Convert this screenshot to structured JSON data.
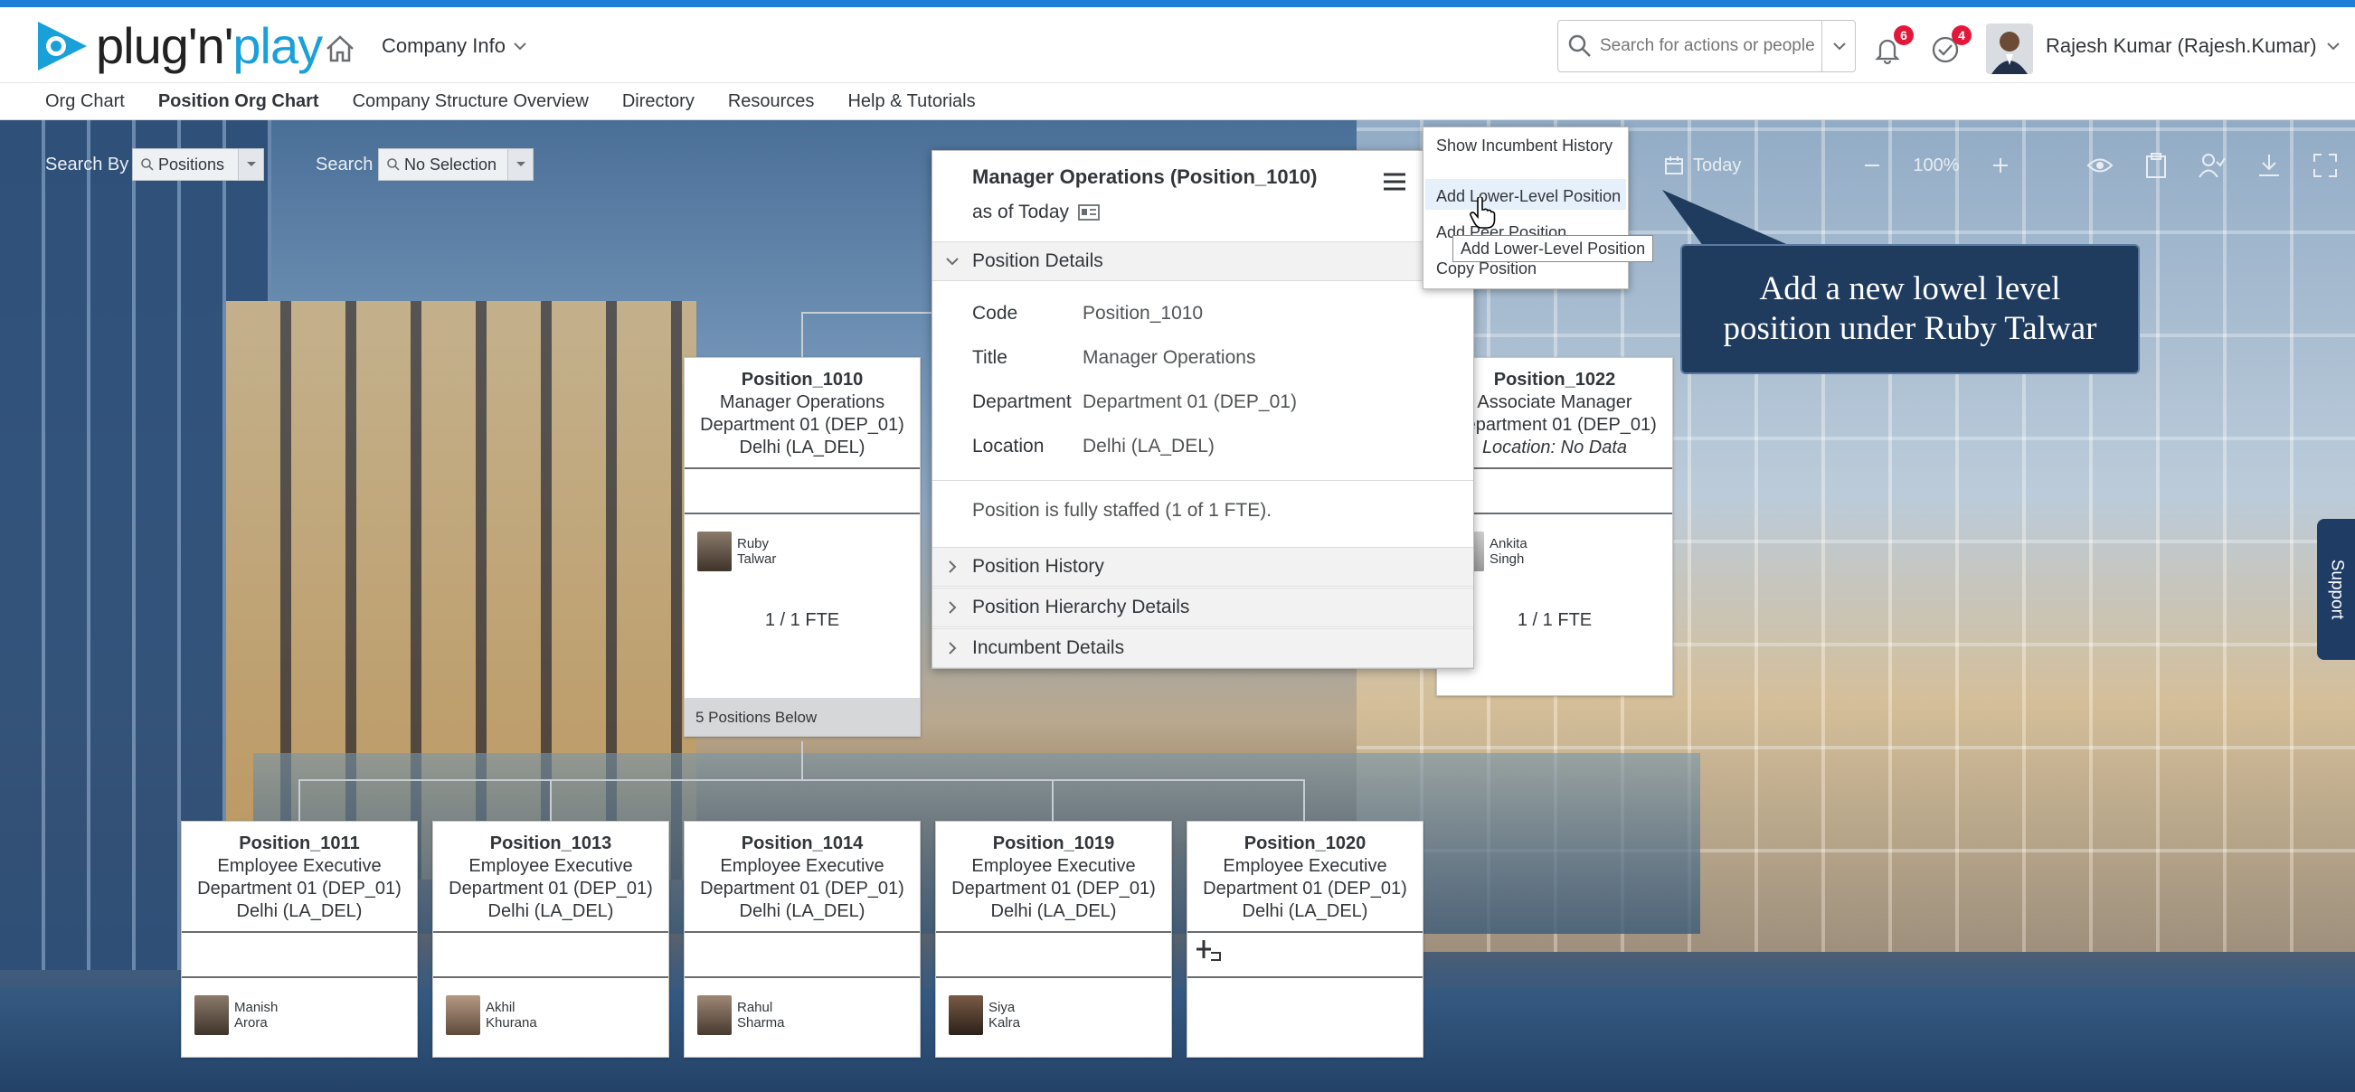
{
  "header": {
    "logo_text_a": "plug'n'",
    "logo_text_b": "play",
    "company_menu": "Company Info",
    "search_placeholder": "Search for actions or people",
    "notifications_count": "6",
    "tasks_count": "4",
    "user_name": "Rajesh Kumar (Rajesh.Kumar)"
  },
  "subnav": {
    "items": [
      "Org Chart",
      "Position Org Chart",
      "Company Structure Overview",
      "Directory",
      "Resources",
      "Help & Tutorials"
    ],
    "active_index": 1
  },
  "toolbar": {
    "search_by_label": "Search By",
    "search_by_value": "Positions",
    "search_label": "Search",
    "search_value": "No Selection",
    "date_value": "Today",
    "zoom_value": "100%"
  },
  "cards": {
    "top_left": {
      "code": "Position_1010",
      "title": "Manager Operations",
      "dept": "Department 01 (DEP_01)",
      "location": "Delhi (LA_DEL)",
      "first": "Ruby",
      "last": "Talwar",
      "fte": "1 / 1 FTE",
      "below": "5 Positions Below"
    },
    "top_right": {
      "code": "Position_1022",
      "title": "Associate Manager",
      "dept": "Department 01 (DEP_01)",
      "location": "Location: No Data",
      "first": "Ankita",
      "last": "Singh",
      "fte": "1 / 1 FTE"
    },
    "bottom": [
      {
        "code": "Position_1011",
        "title": "Employee Executive",
        "dept": "Department 01 (DEP_01)",
        "location": "Delhi (LA_DEL)",
        "first": "Manish",
        "last": "Arora"
      },
      {
        "code": "Position_1013",
        "title": "Employee Executive",
        "dept": "Department 01 (DEP_01)",
        "location": "Delhi (LA_DEL)",
        "first": "Akhil",
        "last": "Khurana"
      },
      {
        "code": "Position_1014",
        "title": "Employee Executive",
        "dept": "Department 01 (DEP_01)",
        "location": "Delhi (LA_DEL)",
        "first": "Rahul",
        "last": "Sharma"
      },
      {
        "code": "Position_1019",
        "title": "Employee Executive",
        "dept": "Department 01 (DEP_01)",
        "location": "Delhi (LA_DEL)",
        "first": "Siya",
        "last": "Kalra"
      },
      {
        "code": "Position_1020",
        "title": "Employee Executive",
        "dept": "Department 01 (DEP_01)",
        "location": "Delhi (LA_DEL)",
        "first": "",
        "last": ""
      }
    ]
  },
  "popover": {
    "title": "Manager Operations (Position_1010)",
    "as_of": "as of Today",
    "section_details": "Position Details",
    "code_label": "Code",
    "code_value": "Position_1010",
    "title_label": "Title",
    "title_value": "Manager Operations",
    "dept_label": "Department",
    "dept_value": "Department 01 (DEP_01)",
    "loc_label": "Location",
    "loc_value": "Delhi (LA_DEL)",
    "staffed": "Position is fully staffed (1 of 1 FTE).",
    "section_history": "Position History",
    "section_hierarchy": "Position Hierarchy Details",
    "section_incumbent": "Incumbent Details"
  },
  "action_menu": {
    "items": [
      "Show Incumbent History",
      "Add Lower-Level Position",
      "Add Peer Position",
      "Copy Position"
    ],
    "highlighted_index": 1,
    "tooltip": "Add Lower-Level Position"
  },
  "callout": {
    "line1": "Add a new lowel level",
    "line2": "position under Ruby Talwar"
  },
  "support_label": "Support",
  "colors": {
    "accent": "#1f7fd6",
    "badge": "#e3173a",
    "callout_bg": "#1f3b5e"
  }
}
